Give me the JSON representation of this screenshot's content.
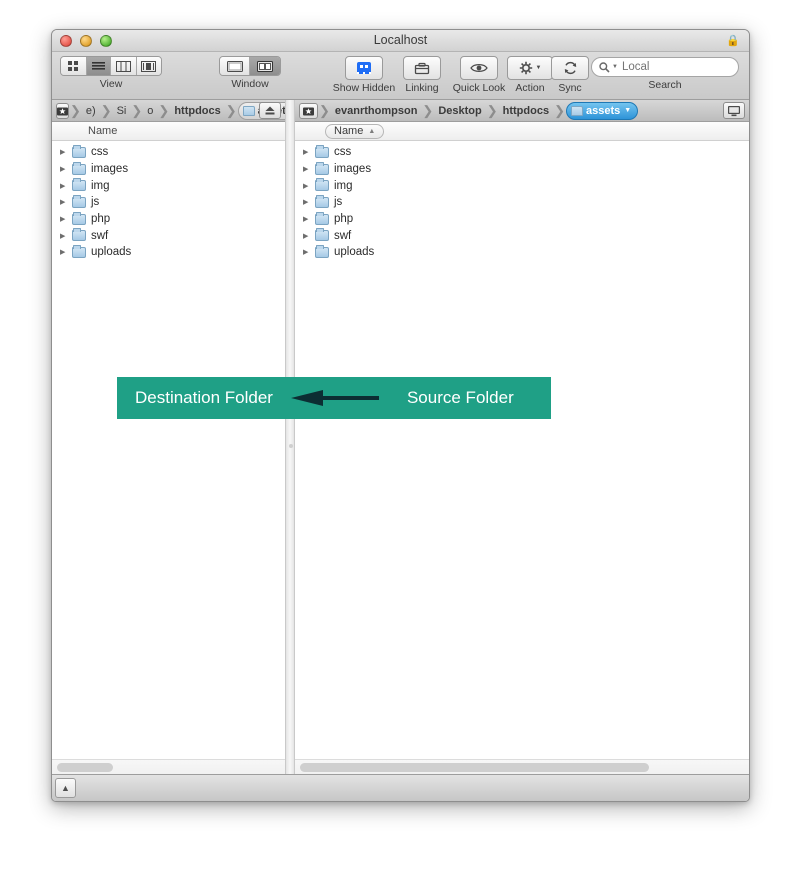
{
  "window": {
    "title": "Localhost",
    "lock_icon": "lock-icon",
    "traffic_lights": [
      "close-button",
      "minimize-button",
      "zoom-button"
    ]
  },
  "toolbar": {
    "view": {
      "label": "View",
      "options": [
        "icon-view",
        "list-view",
        "column-view",
        "coverflow-view"
      ],
      "selected": "list-view"
    },
    "window_group": {
      "label": "Window",
      "options": [
        "single-pane",
        "dual-pane"
      ],
      "selected": "dual-pane"
    },
    "buttons": [
      {
        "label": "Show Hidden",
        "icon": "show-hidden-icon"
      },
      {
        "label": "Linking",
        "icon": "linking-icon"
      },
      {
        "label": "Quick Look",
        "icon": "eye-icon"
      },
      {
        "label": "Action",
        "icon": "gear-icon"
      },
      {
        "label": "Sync",
        "icon": "sync-icon"
      }
    ],
    "search": {
      "label": "Search",
      "placeholder": "Local",
      "value": "",
      "icon": "search-icon"
    }
  },
  "left_pane": {
    "breadcrumb": {
      "home_icon": "home-icon",
      "items": [
        {
          "label": "e)",
          "bold": false,
          "pill": false,
          "active": false
        },
        {
          "label": "Si",
          "bold": false,
          "pill": false,
          "active": false
        },
        {
          "label": "o",
          "bold": false,
          "pill": false,
          "active": false
        },
        {
          "label": "httpdocs",
          "bold": true,
          "pill": false,
          "active": false
        },
        {
          "label": "assets",
          "bold": true,
          "pill": true,
          "active": false
        }
      ],
      "end_button": "eject-icon"
    },
    "column_header": {
      "name": "Name",
      "sorted": false
    },
    "items": [
      {
        "name": "css",
        "icon": "folder-icon"
      },
      {
        "name": "images",
        "icon": "folder-icon"
      },
      {
        "name": "img",
        "icon": "folder-icon"
      },
      {
        "name": "js",
        "icon": "folder-icon"
      },
      {
        "name": "php",
        "icon": "folder-icon"
      },
      {
        "name": "swf",
        "icon": "folder-icon"
      },
      {
        "name": "uploads",
        "icon": "folder-icon"
      }
    ]
  },
  "right_pane": {
    "breadcrumb": {
      "home_icon": "home-icon",
      "items": [
        {
          "label": "evanrthompson",
          "bold": true,
          "pill": false,
          "active": false
        },
        {
          "label": "Desktop",
          "bold": true,
          "pill": false,
          "active": false
        },
        {
          "label": "httpdocs",
          "bold": true,
          "pill": false,
          "active": false
        },
        {
          "label": "assets",
          "bold": true,
          "pill": true,
          "active": true
        }
      ],
      "end_button": "display-icon"
    },
    "column_header": {
      "name": "Name",
      "sorted": true,
      "sort_arrow": "▲"
    },
    "items": [
      {
        "name": "css",
        "icon": "folder-icon"
      },
      {
        "name": "images",
        "icon": "folder-icon"
      },
      {
        "name": "img",
        "icon": "folder-icon"
      },
      {
        "name": "js",
        "icon": "folder-icon"
      },
      {
        "name": "php",
        "icon": "folder-icon"
      },
      {
        "name": "swf",
        "icon": "folder-icon"
      },
      {
        "name": "uploads",
        "icon": "folder-icon"
      }
    ]
  },
  "annotation": {
    "destination_label": "Destination Folder",
    "source_label": "Source Folder",
    "background_color": "#1fa086",
    "arrow_color": "#0c2e33",
    "text_color": "#ffffff",
    "arrow_direction": "left"
  },
  "statusbar": {
    "button_icon": "triangle-up-icon"
  }
}
